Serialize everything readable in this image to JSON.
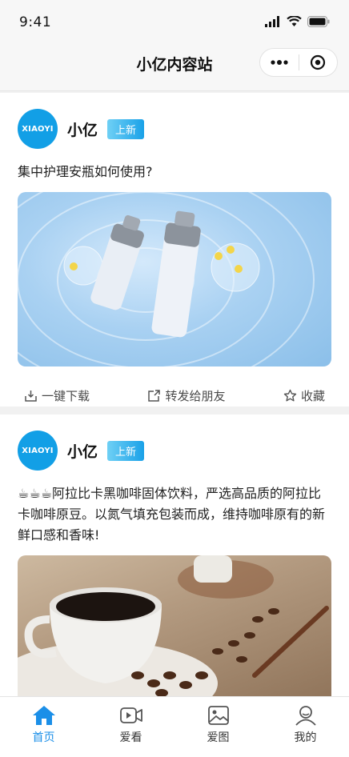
{
  "status_bar": {
    "time": "9:41",
    "icons": [
      "signal-icon",
      "wifi-icon",
      "battery-icon"
    ]
  },
  "nav": {
    "title": "小亿内容站",
    "more_icon": "more-dots-icon",
    "close_icon": "target-circle-icon"
  },
  "posts": [
    {
      "avatar_text": "XIAOYI",
      "author": "小亿",
      "badge": "上新",
      "text": "集中护理安瓶如何使用?",
      "image_icon": "serum-bottles-photo",
      "actions": [
        {
          "label": "一键下载",
          "icon": "download-icon"
        },
        {
          "label": "转发给朋友",
          "icon": "share-icon"
        },
        {
          "label": "收藏",
          "icon": "star-icon"
        }
      ]
    },
    {
      "avatar_text": "XIAOYI",
      "author": "小亿",
      "badge": "上新",
      "text": "☕☕☕阿拉比卡黑咖啡固体饮料，严选高品质的阿拉比卡咖啡原豆。以氮气填充包装而成，维持咖啡原有的新鲜口感和香味!",
      "image_icon": "coffee-cup-photo"
    }
  ],
  "tabbar": {
    "items": [
      {
        "label": "首页",
        "icon": "home-icon",
        "active": true
      },
      {
        "label": "爱看",
        "icon": "video-icon",
        "active": false
      },
      {
        "label": "爱图",
        "icon": "image-icon",
        "active": false
      },
      {
        "label": "我的",
        "icon": "user-icon",
        "active": false
      }
    ]
  },
  "colors": {
    "accent": "#1b8fe8",
    "avatar": "#129fe6",
    "badge": "#1aa1e8"
  }
}
